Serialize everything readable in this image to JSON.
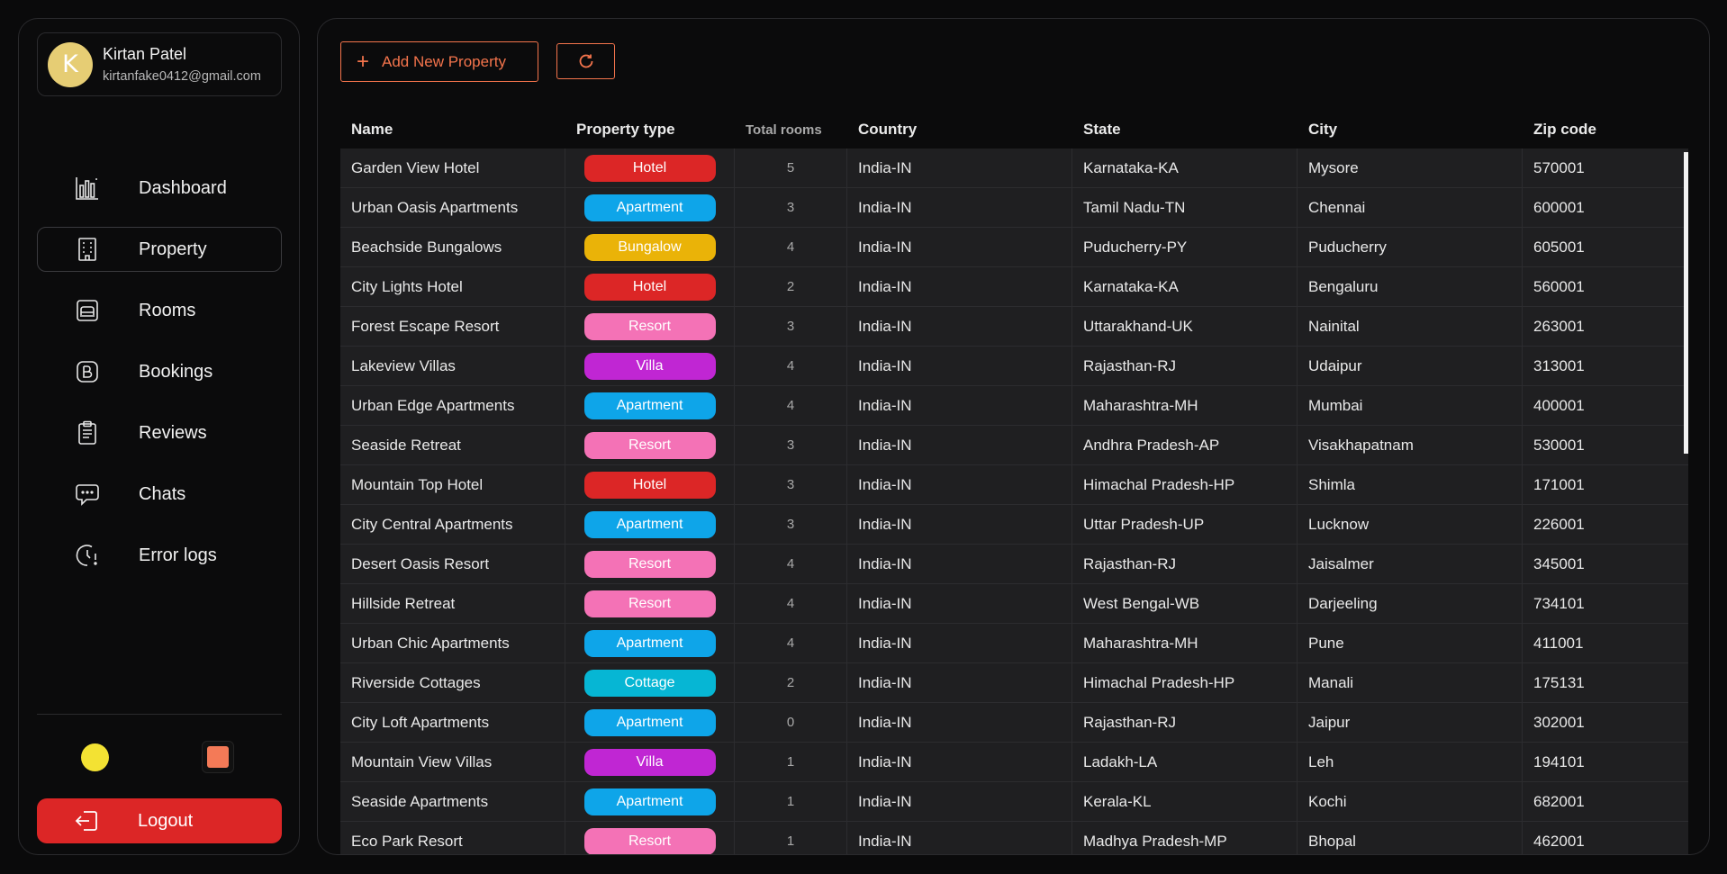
{
  "user": {
    "initial": "K",
    "name": "Kirtan Patel",
    "email": "kirtanfake0412@gmail.com"
  },
  "nav": [
    {
      "label": "Dashboard",
      "icon": "chart-bars-icon",
      "active": false
    },
    {
      "label": "Property",
      "icon": "building-icon",
      "active": true
    },
    {
      "label": "Rooms",
      "icon": "bed-icon",
      "active": false
    },
    {
      "label": "Bookings",
      "icon": "booking-icon",
      "active": false
    },
    {
      "label": "Reviews",
      "icon": "clipboard-icon",
      "active": false
    },
    {
      "label": "Chats",
      "icon": "chat-bubble-icon",
      "active": false
    },
    {
      "label": "Error logs",
      "icon": "error-clock-icon",
      "active": false
    }
  ],
  "theme": {
    "sun_color": "#f3e233",
    "accent_color": "#f47a57"
  },
  "logout_label": "Logout",
  "toolbar": {
    "add_label": "Add New Property",
    "refresh_icon": "refresh-icon"
  },
  "table": {
    "columns": [
      "Name",
      "Property type",
      "Total rooms",
      "Country",
      "State",
      "City",
      "Zip code"
    ],
    "type_colors": {
      "Hotel": "#dc2626",
      "Apartment": "#0ea5e9",
      "Bungalow": "#eab308",
      "Resort": "#f472b6",
      "Villa": "#c026d3",
      "Cottage": "#06b6d4"
    },
    "rows": [
      {
        "name": "Garden View Hotel",
        "type": "Hotel",
        "rooms": "5",
        "country": "India-IN",
        "state": "Karnataka-KA",
        "city": "Mysore",
        "zip": "570001"
      },
      {
        "name": "Urban Oasis Apartments",
        "type": "Apartment",
        "rooms": "3",
        "country": "India-IN",
        "state": "Tamil Nadu-TN",
        "city": "Chennai",
        "zip": "600001"
      },
      {
        "name": "Beachside Bungalows",
        "type": "Bungalow",
        "rooms": "4",
        "country": "India-IN",
        "state": "Puducherry-PY",
        "city": "Puducherry",
        "zip": "605001"
      },
      {
        "name": "City Lights Hotel",
        "type": "Hotel",
        "rooms": "2",
        "country": "India-IN",
        "state": "Karnataka-KA",
        "city": "Bengaluru",
        "zip": "560001"
      },
      {
        "name": "Forest Escape Resort",
        "type": "Resort",
        "rooms": "3",
        "country": "India-IN",
        "state": "Uttarakhand-UK",
        "city": "Nainital",
        "zip": "263001"
      },
      {
        "name": "Lakeview Villas",
        "type": "Villa",
        "rooms": "4",
        "country": "India-IN",
        "state": "Rajasthan-RJ",
        "city": "Udaipur",
        "zip": "313001"
      },
      {
        "name": "Urban Edge Apartments",
        "type": "Apartment",
        "rooms": "4",
        "country": "India-IN",
        "state": "Maharashtra-MH",
        "city": "Mumbai",
        "zip": "400001"
      },
      {
        "name": "Seaside Retreat",
        "type": "Resort",
        "rooms": "3",
        "country": "India-IN",
        "state": "Andhra Pradesh-AP",
        "city": "Visakhapatnam",
        "zip": "530001"
      },
      {
        "name": "Mountain Top Hotel",
        "type": "Hotel",
        "rooms": "3",
        "country": "India-IN",
        "state": "Himachal Pradesh-HP",
        "city": "Shimla",
        "zip": "171001"
      },
      {
        "name": "City Central Apartments",
        "type": "Apartment",
        "rooms": "3",
        "country": "India-IN",
        "state": "Uttar Pradesh-UP",
        "city": "Lucknow",
        "zip": "226001"
      },
      {
        "name": "Desert Oasis Resort",
        "type": "Resort",
        "rooms": "4",
        "country": "India-IN",
        "state": "Rajasthan-RJ",
        "city": "Jaisalmer",
        "zip": "345001"
      },
      {
        "name": "Hillside Retreat",
        "type": "Resort",
        "rooms": "4",
        "country": "India-IN",
        "state": "West Bengal-WB",
        "city": "Darjeeling",
        "zip": "734101"
      },
      {
        "name": "Urban Chic Apartments",
        "type": "Apartment",
        "rooms": "4",
        "country": "India-IN",
        "state": "Maharashtra-MH",
        "city": "Pune",
        "zip": "411001"
      },
      {
        "name": "Riverside Cottages",
        "type": "Cottage",
        "rooms": "2",
        "country": "India-IN",
        "state": "Himachal Pradesh-HP",
        "city": "Manali",
        "zip": "175131"
      },
      {
        "name": "City Loft Apartments",
        "type": "Apartment",
        "rooms": "0",
        "country": "India-IN",
        "state": "Rajasthan-RJ",
        "city": "Jaipur",
        "zip": "302001"
      },
      {
        "name": "Mountain View Villas",
        "type": "Villa",
        "rooms": "1",
        "country": "India-IN",
        "state": "Ladakh-LA",
        "city": "Leh",
        "zip": "194101"
      },
      {
        "name": "Seaside Apartments",
        "type": "Apartment",
        "rooms": "1",
        "country": "India-IN",
        "state": "Kerala-KL",
        "city": "Kochi",
        "zip": "682001"
      },
      {
        "name": "Eco Park Resort",
        "type": "Resort",
        "rooms": "1",
        "country": "India-IN",
        "state": "Madhya Pradesh-MP",
        "city": "Bhopal",
        "zip": "462001"
      }
    ]
  }
}
